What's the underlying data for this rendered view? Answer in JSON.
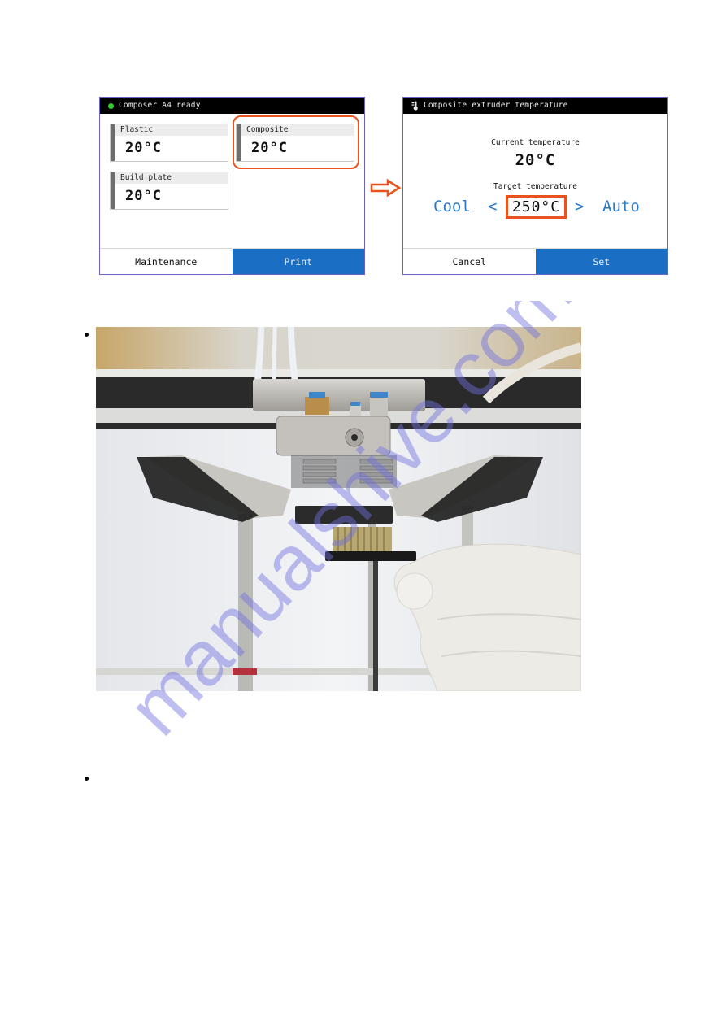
{
  "home_screen": {
    "status_text": "Composer A4 ready",
    "status_color": "#2ecc2e",
    "tiles": [
      {
        "label": "Plastic",
        "value": "20°C"
      },
      {
        "label": "Composite",
        "value": "20°C"
      },
      {
        "label": "Build plate",
        "value": "20°C"
      }
    ],
    "highlighted_tile": "Composite",
    "buttons": {
      "maintenance": "Maintenance",
      "print": "Print"
    }
  },
  "temperature_screen": {
    "title": "Composite extruder temperature",
    "current_label": "Current temperature",
    "current_value": "20°C",
    "target_label": "Target temperature",
    "target_value": "250°C",
    "cool_label": "Cool",
    "decrease_glyph": "<",
    "increase_glyph": ">",
    "auto_label": "Auto",
    "buttons": {
      "cancel": "Cancel",
      "set": "Set"
    }
  },
  "colors": {
    "accent_blue": "#1a6fc4",
    "highlight_orange": "#e8531f",
    "titlebar": "#000000"
  },
  "photo": {
    "alt": "Cleaning the composite extruder nozzle with a brass wire brush held in a gloved hand"
  },
  "watermark": "manualshive.com",
  "bullets": [
    "",
    ""
  ]
}
